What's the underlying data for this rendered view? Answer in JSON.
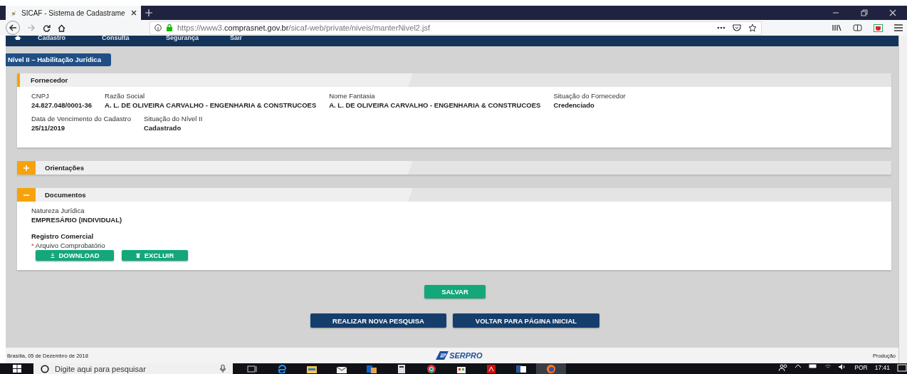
{
  "browser": {
    "tab_title": "SICAF - Sistema de Cadastrame",
    "url_scheme": "https://www3.",
    "url_domain": "comprasnet.gov.br",
    "url_path": "/sicaf-web/private/niveis/manterNivel2.jsf"
  },
  "nav": [
    "Cadastro",
    "Consulta",
    "Segurança",
    "Sair"
  ],
  "page_title": "Nível II – Habilitação Jurídica",
  "panels": [
    {
      "kind": "fields",
      "title": "Fornecedor",
      "rows": [
        [
          {
            "label": "CNPJ",
            "value": "24.827.048/0001-36"
          },
          {
            "label": "Razão Social",
            "value": "A. L. DE OLIVEIRA CARVALHO - ENGENHARIA & CONSTRUCOES"
          },
          {
            "label": "Nome Fantasia",
            "value": "A. L. DE OLIVEIRA CARVALHO - ENGENHARIA & CONSTRUCOES"
          },
          {
            "label": "Situação do Fornecedor",
            "value": "Credenciado"
          }
        ],
        [
          {
            "label": "Data de Vencimento do Cadastro",
            "value": "25/11/2019"
          },
          {
            "label": "Situação do Nível II",
            "value": "Cadastrado"
          }
        ]
      ]
    },
    {
      "kind": "collapsible",
      "title": "Orientações",
      "expanded": false
    },
    {
      "kind": "collapsible",
      "title": "Documentos",
      "expanded": true,
      "field": {
        "label": "Natureza Jurídica",
        "value": "EMPRESÁRIO (INDIVIDUAL)"
      },
      "section": "Registro Comercial",
      "file_label": {
        "marker": "*",
        "text": "Arquivo Comprobatório"
      },
      "buttons": [
        {
          "kind": "download",
          "label": "DOWNLOAD"
        },
        {
          "kind": "delete",
          "label": "EXCLUIR"
        }
      ]
    }
  ],
  "save_button": "SALVAR",
  "nav_buttons": [
    "REALIZAR NOVA PESQUISA",
    "VOLTAR PARA PÁGINA INICIAL"
  ],
  "footer": {
    "date": "Brasília, 05 de Dezembro de 2018",
    "logo": "SERPRO",
    "environment": "Produção"
  },
  "taskbar": {
    "search_placeholder": "Digite aqui para pesquisar",
    "language": "POR",
    "time": "17:41"
  }
}
